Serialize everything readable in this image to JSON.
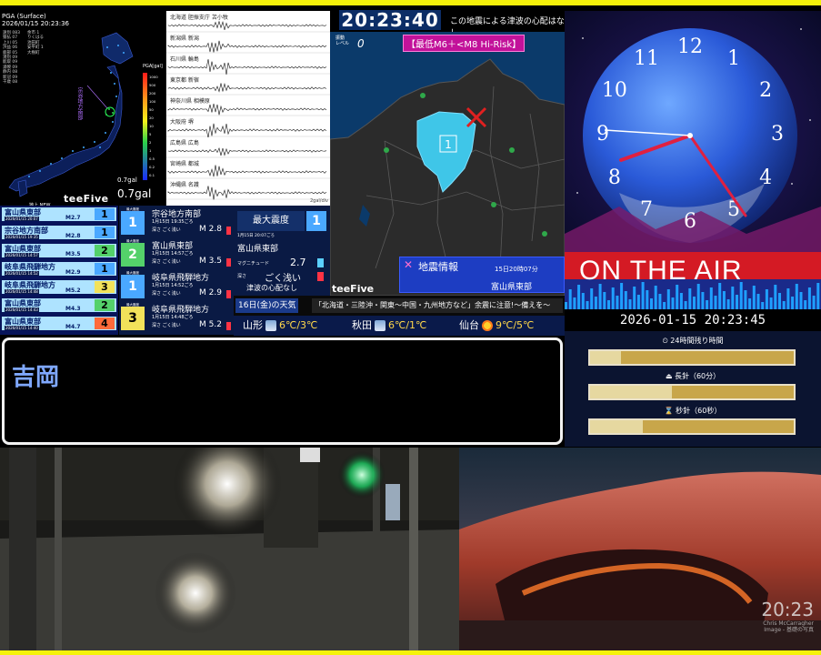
{
  "shake_map": {
    "timestamp": "2026/01/15 20:23:36",
    "header": "PGA (Surface)",
    "stations_left": [
      "遠別 083",
      "猿払 07",
      "上川 05",
      "浜益 06",
      "鹿部 05",
      "湧別 09",
      "能取 09",
      "浦幌 09",
      "静内 08",
      "新冠 09",
      "千歳 08"
    ],
    "stations_right": [
      "余市 1",
      "りくはる",
      "池田町",
      "安平町 1",
      "大樹町"
    ],
    "region_label": "宗谷地方南部",
    "legend_title": "PGA[gal]",
    "legend_ticks": [
      "1000",
      "500",
      "200",
      "100",
      "50",
      "20",
      "10",
      "5",
      "2",
      "1",
      "0.5",
      "0.2",
      "0.1"
    ],
    "gal_small": "0.7gal",
    "gal": "0.7gal",
    "map_new": "地上 NEW",
    "brand": "teeFive"
  },
  "waveforms": {
    "rows": [
      {
        "label": "北海道 胆振支庁 苫小牧"
      },
      {
        "label": "新潟県 新潟"
      },
      {
        "label": "石川県 輪島"
      },
      {
        "label": "東京都 新宿"
      },
      {
        "label": "神奈川県 相模原"
      },
      {
        "label": "大阪府 堺"
      },
      {
        "label": "広島県 広島"
      },
      {
        "label": "宮崎県 都城"
      },
      {
        "label": "沖縄県 名護"
      }
    ],
    "unit": "2gal/div"
  },
  "eq_list": [
    {
      "name": "富山県東部",
      "date": "2026/01/15 20:07",
      "mag": "M2.7",
      "shindo": "1",
      "color": "#4aa8ff"
    },
    {
      "name": "宗谷地方南部",
      "date": "2026/01/15 19:35",
      "mag": "M2.8",
      "shindo": "1",
      "color": "#4aa8ff"
    },
    {
      "name": "富山県東部",
      "date": "2026/01/15 14:57",
      "mag": "M3.5",
      "shindo": "2",
      "color": "#54d16a"
    },
    {
      "name": "岐阜県飛騨地方",
      "date": "2026/01/15 14:52",
      "mag": "M2.9",
      "shindo": "1",
      "color": "#4aa8ff"
    },
    {
      "name": "岐阜県飛騨地方",
      "date": "2026/01/15 14:48",
      "mag": "M5.2",
      "shindo": "3",
      "color": "#f2e25a"
    },
    {
      "name": "富山県東部",
      "date": "2026/01/15 14:43",
      "mag": "M4.3",
      "shindo": "2",
      "color": "#54d16a"
    },
    {
      "name": "富山県東部",
      "date": "2026/01/15 14:40",
      "mag": "M4.7",
      "shindo": "4",
      "color": "#ff6a3a"
    }
  ],
  "eq_detail": [
    {
      "label": "最大震度",
      "shindo": "1",
      "name": "宗谷地方南部",
      "date": "1月15日 19:35ごろ",
      "depth": "深さ ごく浅い",
      "mag": "M 2.8",
      "color": "#4aa8ff",
      "bar": "#ff3344"
    },
    {
      "label": "最大震度",
      "shindo": "2",
      "name": "富山県東部",
      "date": "1月15日 14:57ごろ",
      "depth": "深さ ごく浅い",
      "mag": "M 3.5",
      "color": "#54d16a",
      "bar": "#ff3344"
    },
    {
      "label": "最大震度",
      "shindo": "1",
      "name": "岐阜県飛騨地方",
      "date": "1月15日 14:52ごろ",
      "depth": "深さ ごく浅い",
      "mag": "M 2.9",
      "color": "#4aa8ff",
      "bar": "#ff3344"
    },
    {
      "label": "最大震度",
      "shindo": "3",
      "name": "岐阜県飛騨地方",
      "date": "1月15日 14:48ごろ",
      "depth": "深さ ごく浅い",
      "mag": "M 5.2",
      "color": "#f2e25a",
      "bar": "#ff3344"
    }
  ],
  "max_intensity": {
    "heading": "最大震度",
    "value": "1",
    "date": "1月15日 20:07ごろ",
    "name": "富山県東部",
    "mag_label": "マグニチュード",
    "mag": "2.7",
    "depth_label": "深さ",
    "depth": "ごく浅い"
  },
  "tsunami": "津波の心配なし",
  "ticker": {
    "date": "16日(金)の天気",
    "message": "「北海道・三陸沖・関東〜中国・九州地方など」余震に注意!〜備えを〜"
  },
  "weather": [
    {
      "city": "山形",
      "temp": "6℃/3℃",
      "icon": "cloud-snow-icon"
    },
    {
      "city": "秋田",
      "temp": "6℃/1℃",
      "icon": "cloud-snow-icon"
    },
    {
      "city": "仙台",
      "temp": "9℃/5℃",
      "icon": "sun-icon"
    }
  ],
  "clock_bar": {
    "time": "20:23:40",
    "note": "この地震による津波の心配はなし"
  },
  "map": {
    "shindo_label": "振動",
    "level_label": "レベル",
    "level": "0",
    "risk": "【最低M6＋<M8 Hi-Risk】",
    "epicenter_shindo": "1",
    "info_title": "地震情報",
    "info_time": "15日20時07分",
    "info_region": "富山県東部",
    "brand": "teeFive"
  },
  "onair": {
    "text": "ON THE AIR"
  },
  "stamp": "2026-01-15 20:23:45",
  "progress": [
    {
      "label": "24時間残り時間",
      "fraction": 0.15
    },
    {
      "label": "長針（60分）",
      "fraction": 0.4
    },
    {
      "label": "秒針（60秒）",
      "fraction": 0.26
    }
  ],
  "name_bar": {
    "name": "吉岡"
  },
  "cam2": {
    "clock": "20:23",
    "credit1": "Chris McCarragher",
    "credit2": "Image - 基礎の写真"
  }
}
